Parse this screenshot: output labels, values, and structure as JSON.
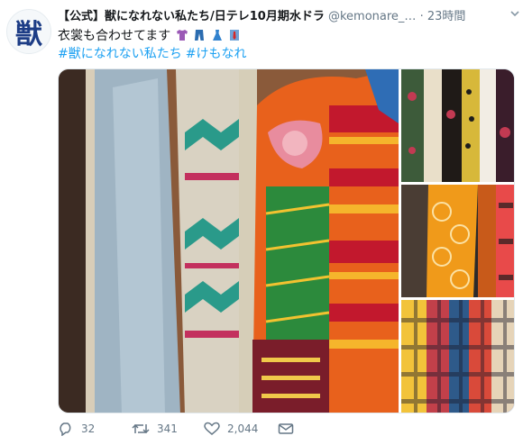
{
  "account": {
    "avatar_glyph": "獣",
    "display_name": "【公式】獣になれない私たち/日テレ10月期水ドラ",
    "handle": "@kemonare_…",
    "separator": "·",
    "time": "23時間"
  },
  "tweet": {
    "text": "衣裳も合わせてます",
    "emoji_icons": [
      "t-shirt-icon",
      "jeans-icon",
      "dress-icon",
      "necktie-icon"
    ],
    "hashtags": [
      "#獣になれない私たち",
      "#けもなれ"
    ]
  },
  "media": {
    "image_count": 4,
    "descriptions": []
  },
  "actions": {
    "reply_count": "32",
    "retweet_count": "341",
    "like_count": "2,044"
  },
  "colors": {
    "link": "#1da1f2",
    "muted": "#657786",
    "text": "#14171a"
  }
}
